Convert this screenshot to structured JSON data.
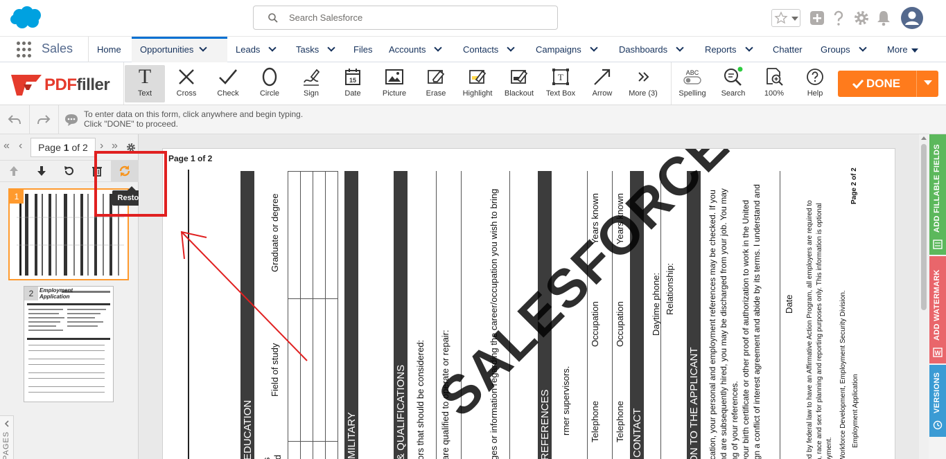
{
  "header": {
    "search_placeholder": "Search Salesforce"
  },
  "nav": {
    "app_name": "Sales",
    "items": [
      {
        "label": "Home"
      },
      {
        "label": "Opportunities"
      },
      {
        "label": "Leads"
      },
      {
        "label": "Tasks"
      },
      {
        "label": "Files"
      },
      {
        "label": "Accounts"
      },
      {
        "label": "Contacts"
      },
      {
        "label": "Campaigns"
      },
      {
        "label": "Dashboards"
      },
      {
        "label": "Reports"
      },
      {
        "label": "Chatter"
      },
      {
        "label": "Groups"
      },
      {
        "label": "More"
      }
    ]
  },
  "toolbar": {
    "tools": [
      {
        "label": "Text"
      },
      {
        "label": "Cross"
      },
      {
        "label": "Check"
      },
      {
        "label": "Circle"
      },
      {
        "label": "Sign"
      },
      {
        "label": "Date"
      },
      {
        "label": "Picture"
      },
      {
        "label": "Erase"
      },
      {
        "label": "Highlight"
      },
      {
        "label": "Blackout"
      },
      {
        "label": "Text Box"
      },
      {
        "label": "Arrow"
      },
      {
        "label": "More (3)"
      }
    ],
    "right_tools": [
      {
        "label": "Spelling",
        "badge": "ABC"
      },
      {
        "label": "Search"
      },
      {
        "label": "100%"
      },
      {
        "label": "Help"
      }
    ],
    "done_label": "DONE",
    "logo_pdf": "PDF",
    "logo_filler": "filler"
  },
  "hint": {
    "line1": "To enter data on this form, click anywhere and begin typing.",
    "line2": "Click \"DONE\" to proceed."
  },
  "sidebar": {
    "page_word": "Page",
    "current_page": "1",
    "of_text": "of 2",
    "tooltip": "Restore",
    "pages_tab": "PAGES",
    "thumbs": [
      {
        "num": "1"
      },
      {
        "num": "2",
        "title1": "Employment",
        "title2": "Application"
      }
    ]
  },
  "document": {
    "page_label": "Page 1 of 2",
    "texts": {
      "education": "EDUCATION",
      "graduate": "Graduate or degree",
      "field_of_study": "Field of study",
      "military": "MILITARY",
      "qualifications": "& QUALIFICATIONS",
      "considered": "ors that should be considered:",
      "operate": "are qualified to operate or repair:",
      "career": "ges or information regarding the career/occupation you wish to bring",
      "references": "REFERENCES",
      "supervisors": "rmer supervisors.",
      "years_known1": "Years known",
      "years_known2": "Years known",
      "occupation1": "Occupation",
      "occupation2": "Occupation",
      "telephone1": "Telephone",
      "telephone2": "Telephone",
      "contact": "CONTACT",
      "daytime": "Daytime phone:",
      "relationship": "Relationship:",
      "to_applicant": "ON TO THE APPLICANT",
      "para1": "ication, your personal and employment references may be checked. If you",
      "para2": "nd are subsequently hired, you may be discharged from your job. You may",
      "para3": "ng of your references.",
      "para4": "your birth certificate or other proof of authorization to work in the United",
      "para5": "ign a conflict of interest agreement and abide by its terms. I understand and",
      "date": "Date",
      "foot1": "ed by federal law to have an Affirmative Action Program, all employers are required to",
      "foot2": "n, race and sex for planning and reporting purposes only. This information is optional",
      "foot3": "oyment.",
      "foot4": "Workforce Development, Employment Security Division.",
      "foot5": "Employment Application",
      "page2of2": "Page 2 of 2",
      "watermark": "SALESFORCE",
      "s_frag": "s",
      "ted_frag": "ted"
    }
  },
  "right_tabs": [
    {
      "label": "ADD FILLABLE FIELDS",
      "color": "#5cb85c"
    },
    {
      "label": "ADD WATERMARK",
      "color": "#e9666b"
    },
    {
      "label": "VERSIONS",
      "color": "#3b9bd4"
    }
  ]
}
